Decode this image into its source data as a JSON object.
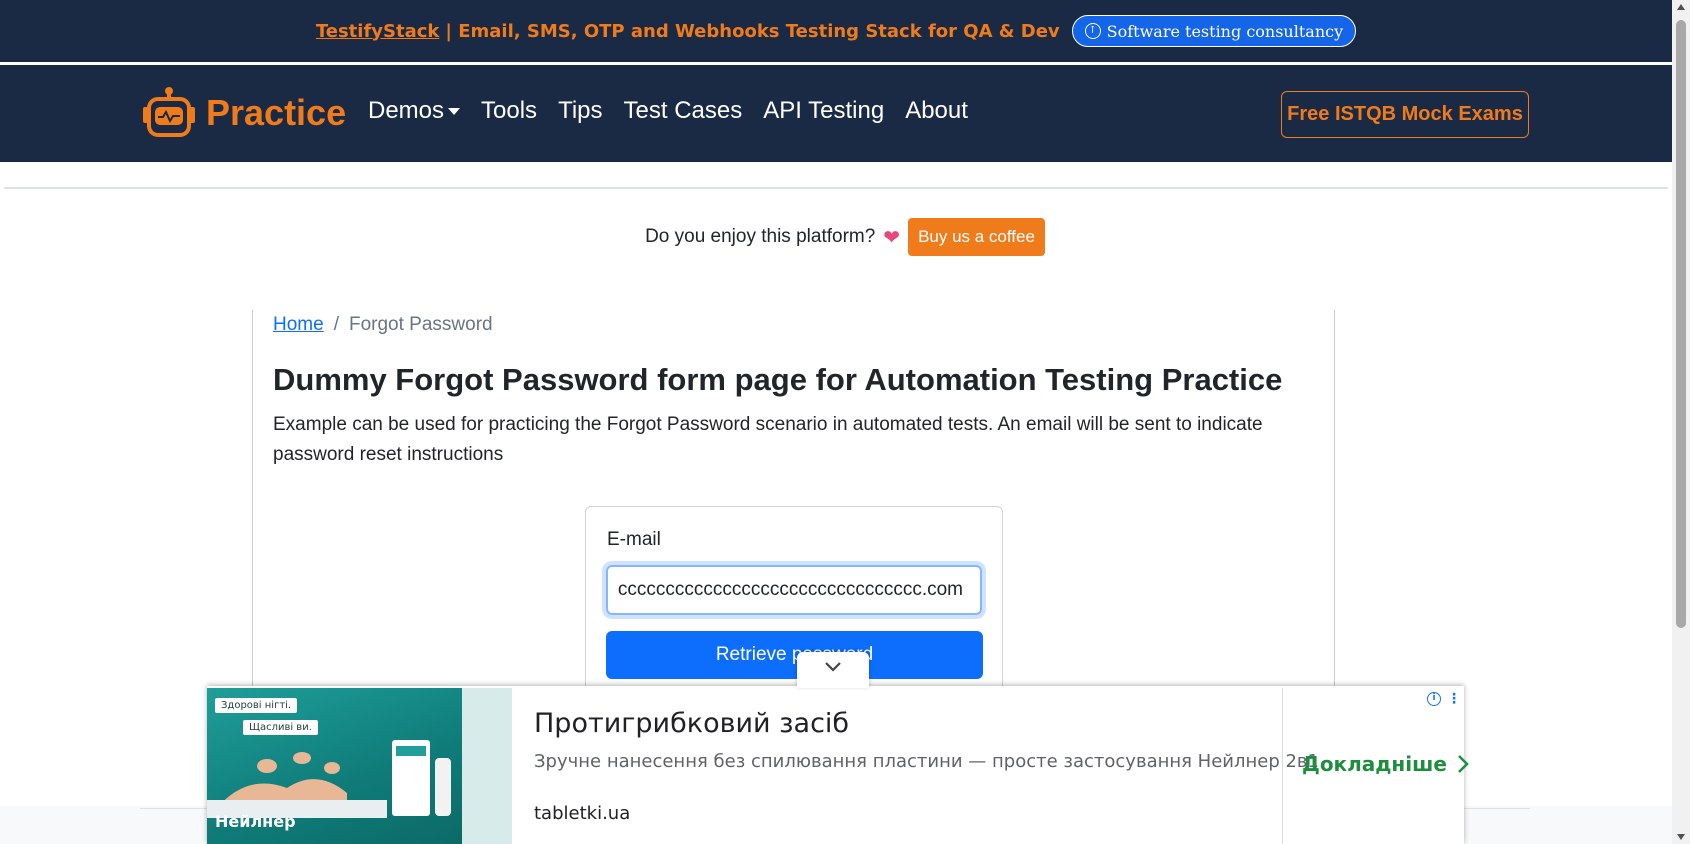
{
  "topbar": {
    "stack_link": "TestifyStack",
    "stack_text": "| Email, SMS, OTP and Webhooks Testing Stack for QA & Dev",
    "consult_button": "Software testing consultancy"
  },
  "navbar": {
    "brand": "Practice",
    "links": [
      "Demos",
      "Tools",
      "Tips",
      "Test Cases",
      "API Testing",
      "About"
    ],
    "cta_button": "Free ISTQB Mock Exams"
  },
  "coffee": {
    "question": "Do you enjoy this platform?",
    "button": "Buy us a coffee"
  },
  "breadcrumb": {
    "home": "Home",
    "separator": "/",
    "current": "Forgot Password"
  },
  "page": {
    "title": "Dummy Forgot Password form page for Automation Testing Practice",
    "description": "Example can be used for practicing the Forgot Password scenario in automated tests. An email will be sent to indicate password reset instructions"
  },
  "form": {
    "email_label": "E-mail",
    "email_value": "cccccccccccccccccccccccccccccccc.com",
    "submit_button": "Retrieve password",
    "submit_button_visible": "Retrieve p         d"
  },
  "ad": {
    "image_tag1": "Здорові нігті.",
    "image_tag2": "Щасливі ви.",
    "image_brand": "Нейлнер",
    "title": "Протигрибковий засіб",
    "description": "Зручне нанесення без спилювання пластини — просте застосування Нейлнер 2в1",
    "domain": "tabletki.ua",
    "cta": "Докладніше"
  },
  "colors": {
    "navy": "#1b2a44",
    "orange": "#f07b1a",
    "primary": "#0d6efd",
    "ad_green": "#1e8e3e"
  }
}
